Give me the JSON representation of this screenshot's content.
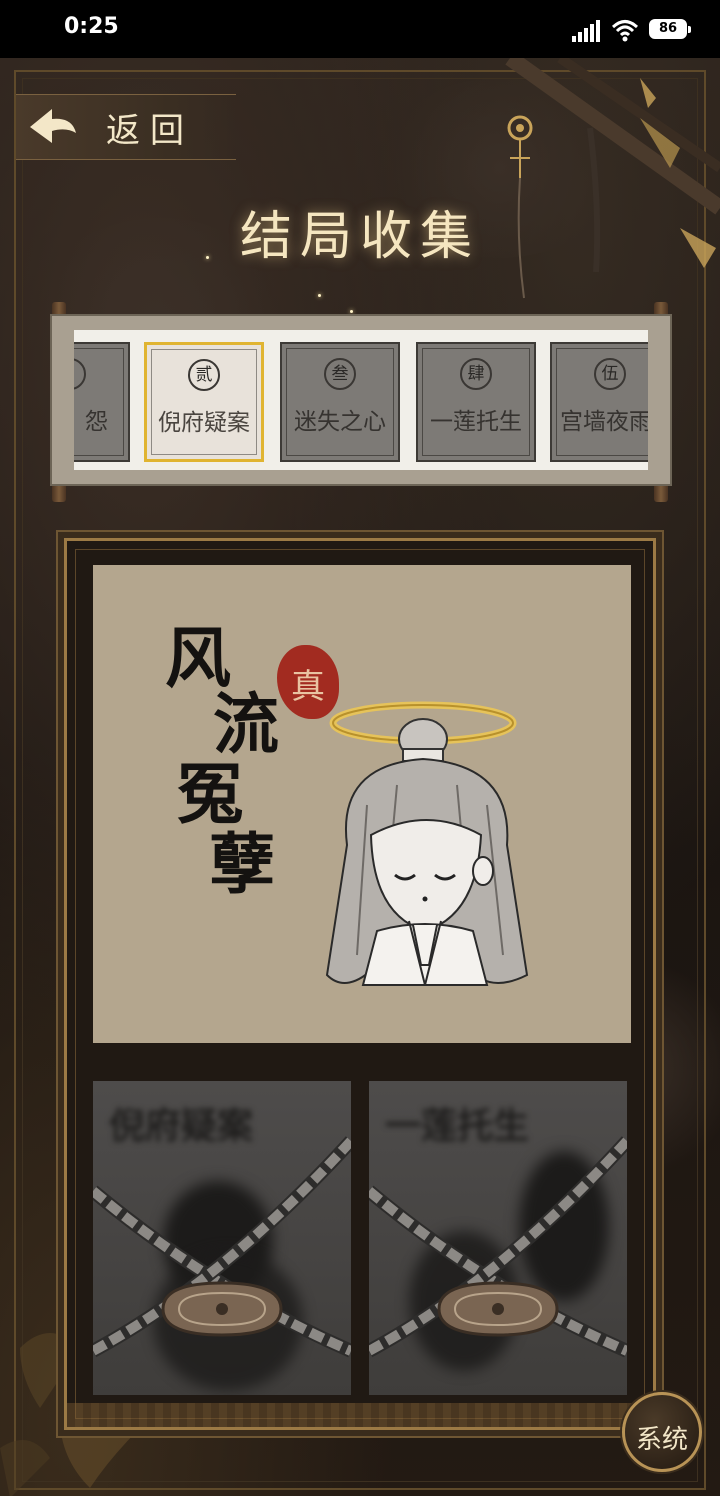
{
  "status_bar": {
    "time": "0:25",
    "battery": "86"
  },
  "header": {
    "back_label": "返回",
    "title": "结局收集"
  },
  "tabs": [
    {
      "num": "",
      "label": "怨",
      "state": "locked"
    },
    {
      "num": "贰",
      "label": "倪府疑案",
      "state": "active"
    },
    {
      "num": "叁",
      "label": "迷失之心",
      "state": "locked"
    },
    {
      "num": "肆",
      "label": "一莲托生",
      "state": "locked"
    },
    {
      "num": "伍",
      "label": "宫墙夜雨",
      "state": "locked"
    }
  ],
  "ending": {
    "title_chars": [
      "风",
      "流",
      "冤",
      "孽"
    ],
    "seal": "真"
  },
  "locked_endings": [
    {
      "blurred_title": "倪府疑案",
      "state": "locked"
    },
    {
      "blurred_title": "一莲托生",
      "state": "locked"
    }
  ],
  "system_button": {
    "label": "系统"
  },
  "colors": {
    "accent_gold": "#e0b431",
    "seal_red": "#a22b20",
    "paper": "#b4a68e"
  }
}
